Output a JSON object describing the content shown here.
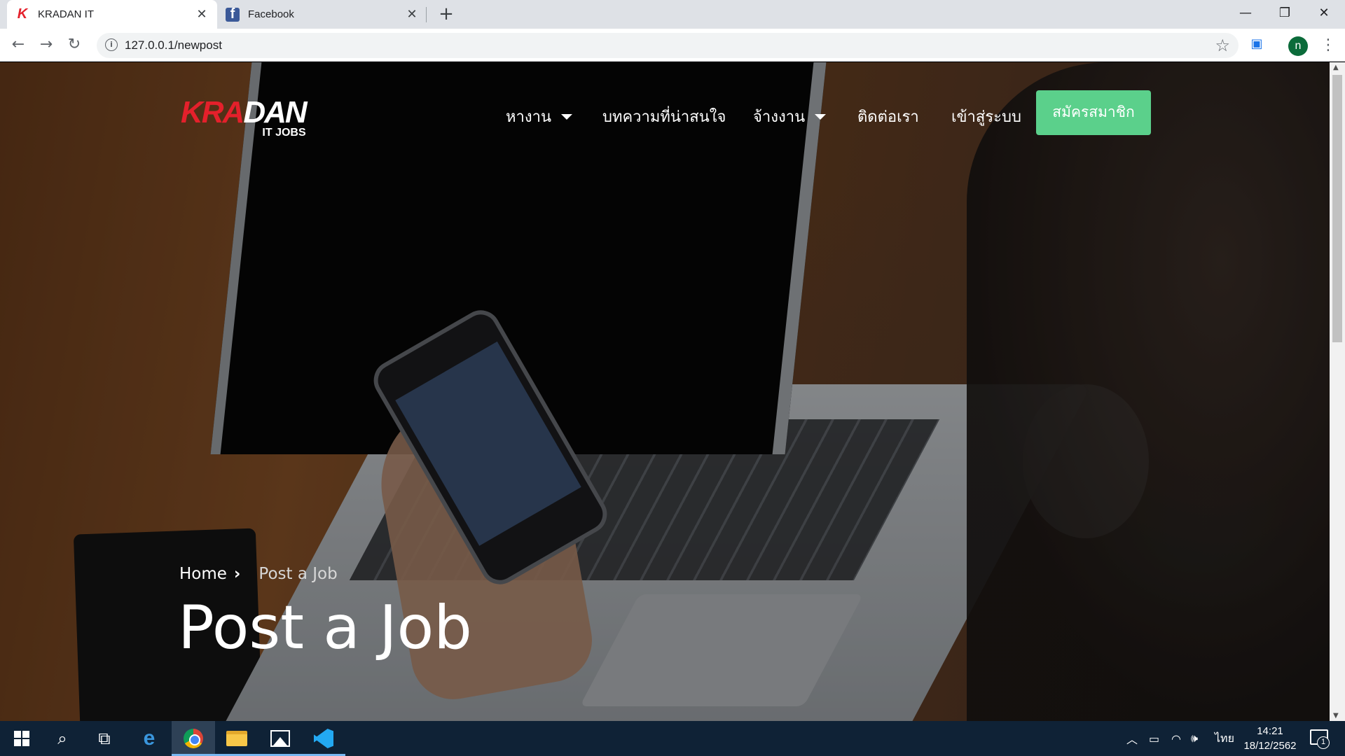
{
  "browser": {
    "tabs": [
      {
        "title": "KRADAN IT",
        "favicon": "kradan-k-icon",
        "active": true
      },
      {
        "title": "Facebook",
        "favicon": "facebook-icon",
        "active": false
      }
    ],
    "new_tab_label": "+",
    "window_controls": {
      "minimize": "—",
      "restore": "❐",
      "close": "✕"
    },
    "toolbar": {
      "back": "←",
      "forward": "→",
      "reload": "↻"
    },
    "url": "127.0.0.1/newpost",
    "profile_initial": "n",
    "menu": "⋮",
    "bookmark": "☆"
  },
  "site": {
    "logo": {
      "part1": "KRA",
      "part2": "DAN",
      "subtitle": "IT JOBS"
    },
    "nav": {
      "jobs": "หางาน",
      "articles": "บทความที่น่าสนใจ",
      "hire": "จ้างงาน",
      "contact": "ติดต่อเรา",
      "login": "เข้าสู่ระบบ",
      "signup": "สมัครสมาชิก"
    },
    "breadcrumb": {
      "home": "Home",
      "separator": "›",
      "current": "Post a Job"
    },
    "hero_title": "Post a Job",
    "colors": {
      "logo_red": "#e4202b",
      "signup_green": "#5bd08b"
    }
  },
  "taskbar": {
    "apps": [
      "start-icon",
      "search-icon",
      "task-view-icon",
      "edge-icon",
      "chrome-icon",
      "file-explorer-icon",
      "photos-icon",
      "vscode-icon"
    ],
    "tray": {
      "language": "ไทย",
      "time": "14:21",
      "date": "18/12/2562",
      "notifications": "1"
    }
  }
}
